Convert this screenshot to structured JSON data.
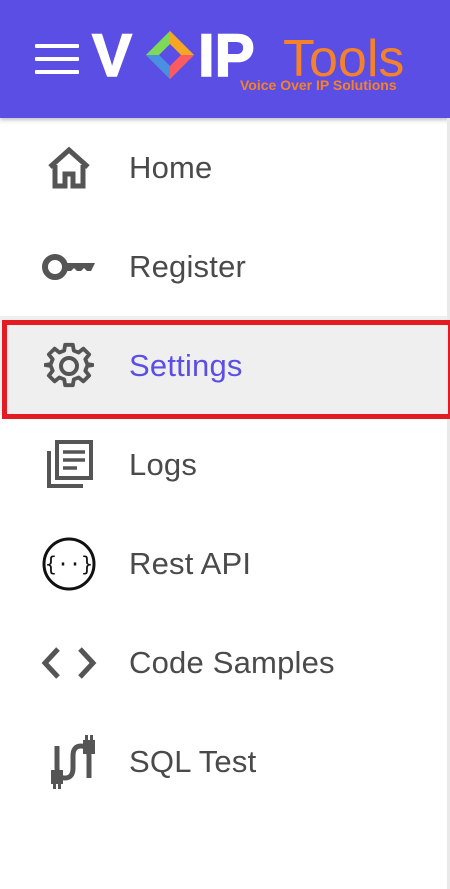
{
  "header": {
    "brand_word_1": "V",
    "brand_word_2": "IP",
    "brand_word_3": "Tools",
    "tagline": "Voice Over IP Solutions",
    "bg_color": "#5b4ee4",
    "accent_color": "#f5822a"
  },
  "menu_button": {
    "icon": "hamburger-menu-icon"
  },
  "nav": {
    "items": [
      {
        "label": "Home",
        "icon": "home-icon",
        "active": false
      },
      {
        "label": "Register",
        "icon": "key-icon",
        "active": false
      },
      {
        "label": "Settings",
        "icon": "gear-icon",
        "active": true
      },
      {
        "label": "Logs",
        "icon": "logs-icon",
        "active": false
      },
      {
        "label": "Rest API",
        "icon": "api-braces-icon",
        "active": false
      },
      {
        "label": "Code Samples",
        "icon": "code-icon",
        "active": false
      },
      {
        "label": "SQL Test",
        "icon": "cable-plug-icon",
        "active": false
      }
    ],
    "active_color": "#5b4ee4",
    "text_color": "#4a4a4a",
    "highlight_color": "#e31b23"
  }
}
